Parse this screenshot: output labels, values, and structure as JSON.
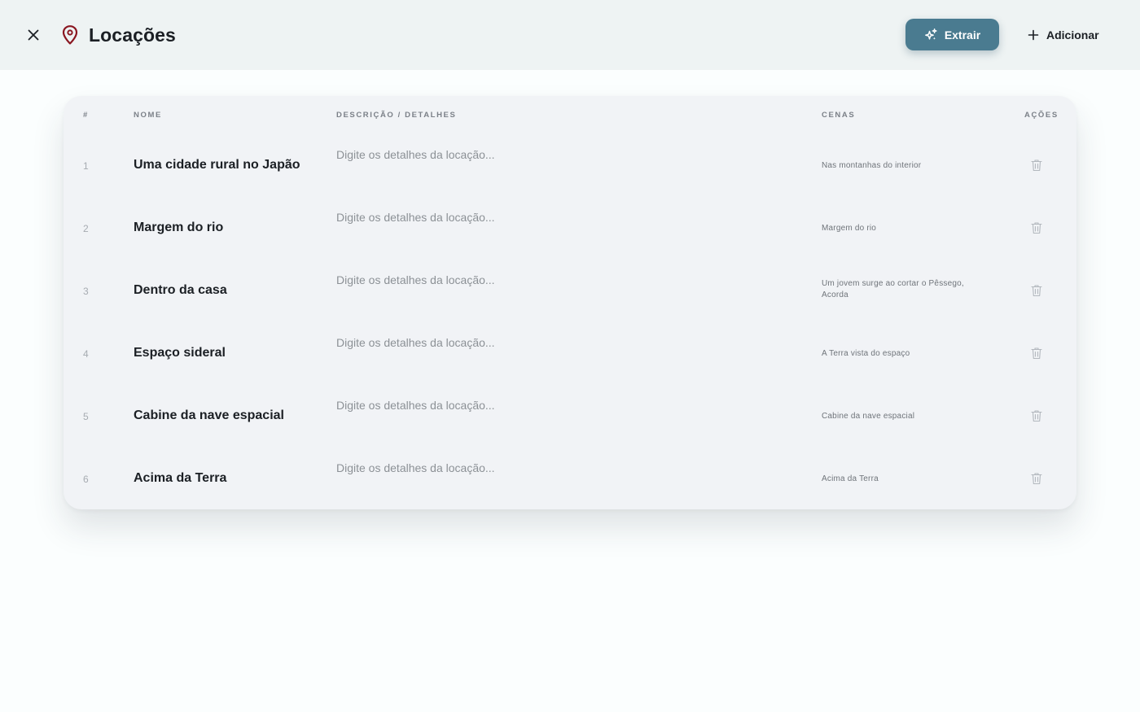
{
  "header": {
    "title": "Locações",
    "extract_label": "Extrair",
    "add_label": "Adicionar"
  },
  "table": {
    "columns": {
      "num": "#",
      "name": "NOME",
      "description": "DESCRIÇÃO / DETALHES",
      "scenes": "CENAS",
      "actions": "AÇÕES"
    },
    "description_placeholder": "Digite os detalhes da locação...",
    "rows": [
      {
        "num": "1",
        "name": "Uma cidade rural no Japão",
        "scenes": "Nas montanhas do interior"
      },
      {
        "num": "2",
        "name": "Margem do rio",
        "scenes": "Margem do rio"
      },
      {
        "num": "3",
        "name": "Dentro da casa",
        "scenes": "Um jovem surge ao cortar o Pêssego, Acorda"
      },
      {
        "num": "4",
        "name": "Espaço sideral",
        "scenes": "A Terra vista do espaço"
      },
      {
        "num": "5",
        "name": "Cabine da nave espacial",
        "scenes": "Cabine da nave espacial"
      },
      {
        "num": "6",
        "name": "Acima da Terra",
        "scenes": "Acima da Terra"
      }
    ]
  },
  "colors": {
    "accent": "#4a7b90",
    "pin": "#8a1620",
    "header_bg": "#eef3f3",
    "card_bg": "#f1f3f6"
  },
  "icons": {
    "close": "close-icon",
    "pin": "map-pin-icon",
    "extract": "sparkles-icon",
    "add": "plus-icon",
    "delete": "trash-icon"
  }
}
